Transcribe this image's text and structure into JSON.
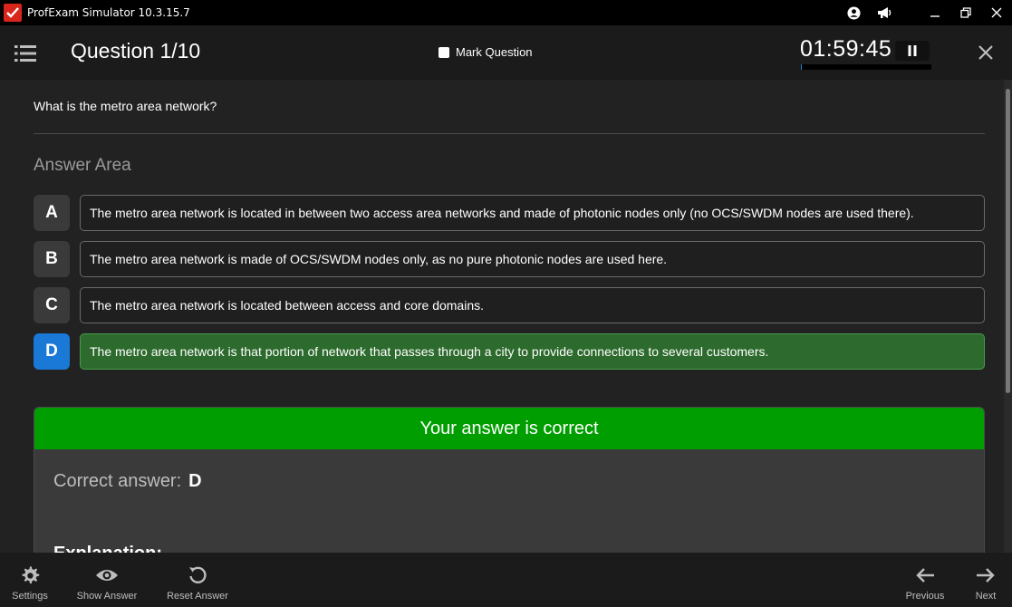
{
  "app": {
    "title": "ProfExam Simulator 10.3.15.7"
  },
  "header": {
    "question_title": "Question 1/10",
    "mark_label": "Mark Question",
    "timer": "01:59:45",
    "timer_progress": 0.01
  },
  "question": {
    "text": "What is the metro area network?"
  },
  "answer_area_label": "Answer Area",
  "options": [
    {
      "letter": "A",
      "text": "The metro area network is located in between two access area networks and made of photonic nodes only (no OCS/SWDM nodes are used there).",
      "selected": false,
      "correct": false
    },
    {
      "letter": "B",
      "text": "The metro area network is made of OCS/SWDM nodes only, as no pure photonic nodes are used here.",
      "selected": false,
      "correct": false
    },
    {
      "letter": "C",
      "text": "The metro area network is located between access and core domains.",
      "selected": false,
      "correct": false
    },
    {
      "letter": "D",
      "text": "The metro area network is that portion of network that passes through a city to provide connections to several customers.",
      "selected": true,
      "correct": true
    }
  ],
  "result": {
    "banner": "Your answer is correct",
    "correct_label": "Correct answer:",
    "correct_value": "D",
    "explanation_label": "Explanation:"
  },
  "footer": {
    "settings": "Settings",
    "show_answer": "Show Answer",
    "reset_answer": "Reset Answer",
    "previous": "Previous",
    "next": "Next"
  },
  "colors": {
    "accent": "#1a78d6",
    "correct_banner": "#009e00",
    "correct_option": "#2d6a2d"
  }
}
